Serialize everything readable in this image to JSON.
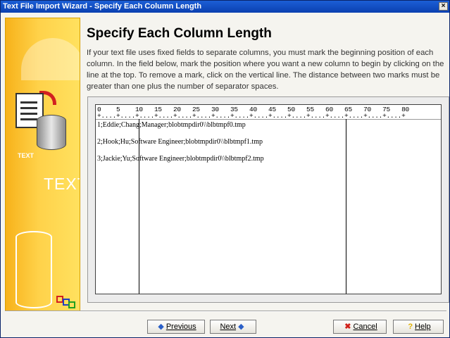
{
  "window": {
    "title": "Text File Import Wizard - Specify Each Column Length",
    "close_label": "×"
  },
  "sidebar": {
    "small_text": "TEXT",
    "big_text": "TEXT"
  },
  "content": {
    "heading": "Specify Each Column Length",
    "description": "If your text file uses fixed fields to separate columns, you must mark the beginning position of each column. In the field below, mark the position where you want a new column to begin by clicking on the line at the top. To remove a mark, click on the vertical line. The distance between two marks must be greater than one plus the number of separator spaces."
  },
  "editor": {
    "ruler_numbers": "0    5    10   15   20   25   30   35   40   45   50   55   60   65   70   75   80",
    "ruler_ticks": "+....+....+....+....+....+....+....+....+....+....+....+....+....+....+....+....+",
    "lines": [
      "1;Eddie;Chang;Manager;blobtmpdir0\\\\blbtmpf0.tmp",
      "2;Hook;Hu;Software Engineer;blobtmpdir0\\\\blbtmpf1.tmp",
      "3;Jackie;Yu;Software Engineer;blobtmpdir0\\\\blbtmpf2.tmp"
    ]
  },
  "buttons": {
    "previous": "Previous",
    "next": "Next",
    "cancel": "Cancel",
    "help": "Help"
  },
  "colors": {
    "titlebar": "#0a3fb0",
    "sidebar": "#ffd24a",
    "cancel_icon": "#d0201a",
    "help_icon": "#e0b000",
    "nav_icon": "#2a5fc8"
  }
}
